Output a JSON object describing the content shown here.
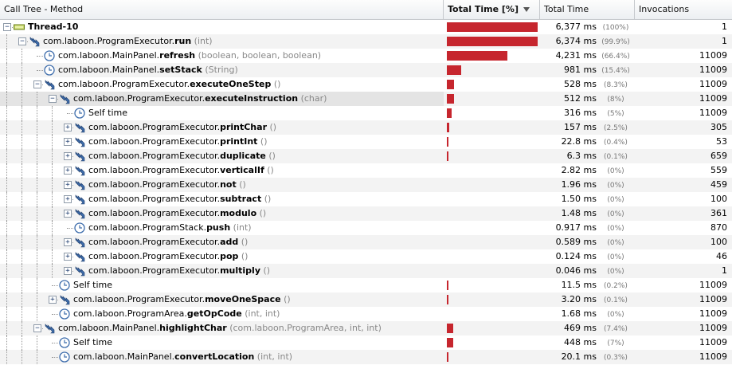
{
  "header": {
    "col_method": "Call Tree - Method",
    "col_total_pct": "Total Time [%]",
    "col_total_time": "Total Time",
    "col_invocations": "Invocations"
  },
  "rows": [
    {
      "icon": "thread",
      "expanded": true,
      "prefix": "",
      "bold": "Thread-10",
      "args": "",
      "ms": "6,377 ms",
      "pct": "(100%)",
      "frac": 1.0,
      "inv": "1"
    },
    {
      "icon": "method",
      "expanded": true,
      "prefix": "com.laboon.ProgramExecutor.",
      "bold": "run",
      "args": "(int)",
      "ms": "6,374 ms",
      "pct": "(99.9%)",
      "frac": 0.999,
      "inv": "1"
    },
    {
      "icon": "clock",
      "prefix": "com.laboon.MainPanel.",
      "bold": "refresh",
      "args": "(boolean, boolean, boolean)",
      "ms": "4,231 ms",
      "pct": "(66.4%)",
      "frac": 0.664,
      "inv": "11009"
    },
    {
      "icon": "clock",
      "prefix": "com.laboon.MainPanel.",
      "bold": "setStack",
      "args": "(String)",
      "ms": "981 ms",
      "pct": "(15.4%)",
      "frac": 0.154,
      "inv": "11009"
    },
    {
      "icon": "method",
      "expanded": true,
      "prefix": "com.laboon.ProgramExecutor.",
      "bold": "executeOneStep",
      "args": "()",
      "ms": "528 ms",
      "pct": "(8.3%)",
      "frac": 0.083,
      "inv": "11009"
    },
    {
      "icon": "method",
      "expanded": true,
      "prefix": "com.laboon.ProgramExecutor.",
      "bold": "executeInstruction",
      "args": "(char)",
      "ms": "512 ms",
      "pct": "(8%)",
      "frac": 0.08,
      "inv": "11009",
      "selected": true
    },
    {
      "icon": "clock",
      "prefix": "Self time",
      "bold": "",
      "args": "",
      "ms": "316 ms",
      "pct": "(5%)",
      "frac": 0.05,
      "inv": "11009"
    },
    {
      "icon": "method",
      "expanded": false,
      "prefix": "com.laboon.ProgramExecutor.",
      "bold": "printChar",
      "args": "()",
      "ms": "157 ms",
      "pct": "(2.5%)",
      "frac": 0.025,
      "inv": "305"
    },
    {
      "icon": "method",
      "expanded": false,
      "prefix": "com.laboon.ProgramExecutor.",
      "bold": "printInt",
      "args": "()",
      "ms": "22.8 ms",
      "pct": "(0.4%)",
      "frac": 0.004,
      "inv": "53"
    },
    {
      "icon": "method",
      "expanded": false,
      "prefix": "com.laboon.ProgramExecutor.",
      "bold": "duplicate",
      "args": "()",
      "ms": "6.3 ms",
      "pct": "(0.1%)",
      "frac": 0.001,
      "inv": "659"
    },
    {
      "icon": "method",
      "expanded": false,
      "prefix": "com.laboon.ProgramExecutor.",
      "bold": "verticalIf",
      "args": "()",
      "ms": "2.82 ms",
      "pct": "(0%)",
      "frac": 0,
      "inv": "559"
    },
    {
      "icon": "method",
      "expanded": false,
      "prefix": "com.laboon.ProgramExecutor.",
      "bold": "not",
      "args": "()",
      "ms": "1.96 ms",
      "pct": "(0%)",
      "frac": 0,
      "inv": "459"
    },
    {
      "icon": "method",
      "expanded": false,
      "prefix": "com.laboon.ProgramExecutor.",
      "bold": "subtract",
      "args": "()",
      "ms": "1.50 ms",
      "pct": "(0%)",
      "frac": 0,
      "inv": "100"
    },
    {
      "icon": "method",
      "expanded": false,
      "prefix": "com.laboon.ProgramExecutor.",
      "bold": "modulo",
      "args": "()",
      "ms": "1.48 ms",
      "pct": "(0%)",
      "frac": 0,
      "inv": "361"
    },
    {
      "icon": "clock",
      "prefix": "com.laboon.ProgramStack.",
      "bold": "push",
      "args": "(int)",
      "ms": "0.917 ms",
      "pct": "(0%)",
      "frac": 0,
      "inv": "870"
    },
    {
      "icon": "method",
      "expanded": false,
      "prefix": "com.laboon.ProgramExecutor.",
      "bold": "add",
      "args": "()",
      "ms": "0.589 ms",
      "pct": "(0%)",
      "frac": 0,
      "inv": "100"
    },
    {
      "icon": "method",
      "expanded": false,
      "prefix": "com.laboon.ProgramExecutor.",
      "bold": "pop",
      "args": "()",
      "ms": "0.124 ms",
      "pct": "(0%)",
      "frac": 0,
      "inv": "46"
    },
    {
      "icon": "method",
      "expanded": false,
      "prefix": "com.laboon.ProgramExecutor.",
      "bold": "multiply",
      "args": "()",
      "ms": "0.046 ms",
      "pct": "(0%)",
      "frac": 0,
      "inv": "1"
    },
    {
      "icon": "clock",
      "prefix": "Self time",
      "bold": "",
      "args": "",
      "ms": "11.5 ms",
      "pct": "(0.2%)",
      "frac": 0.002,
      "inv": "11009"
    },
    {
      "icon": "method",
      "expanded": false,
      "prefix": "com.laboon.ProgramExecutor.",
      "bold": "moveOneSpace",
      "args": "()",
      "ms": "3.20 ms",
      "pct": "(0.1%)",
      "frac": 0.001,
      "inv": "11009"
    },
    {
      "icon": "clock",
      "prefix": "com.laboon.ProgramArea.",
      "bold": "getOpCode",
      "args": "(int, int)",
      "ms": "1.68 ms",
      "pct": "(0%)",
      "frac": 0,
      "inv": "11009"
    },
    {
      "icon": "method",
      "expanded": true,
      "prefix": "com.laboon.MainPanel.",
      "bold": "highlightChar",
      "args": "(com.laboon.ProgramArea, int, int)",
      "ms": "469 ms",
      "pct": "(7.4%)",
      "frac": 0.074,
      "inv": "11009"
    },
    {
      "icon": "clock",
      "prefix": "Self time",
      "bold": "",
      "args": "",
      "ms": "448 ms",
      "pct": "(7%)",
      "frac": 0.07,
      "inv": "11009"
    },
    {
      "icon": "clock",
      "prefix": "com.laboon.MainPanel.",
      "bold": "convertLocation",
      "args": "(int, int)",
      "ms": "20.1 ms",
      "pct": "(0.3%)",
      "frac": 0.003,
      "inv": "11009"
    }
  ],
  "colors": {
    "bar": "#c6262e",
    "header_bg": "#eceff2",
    "alt_row": "#f3f3f3"
  }
}
